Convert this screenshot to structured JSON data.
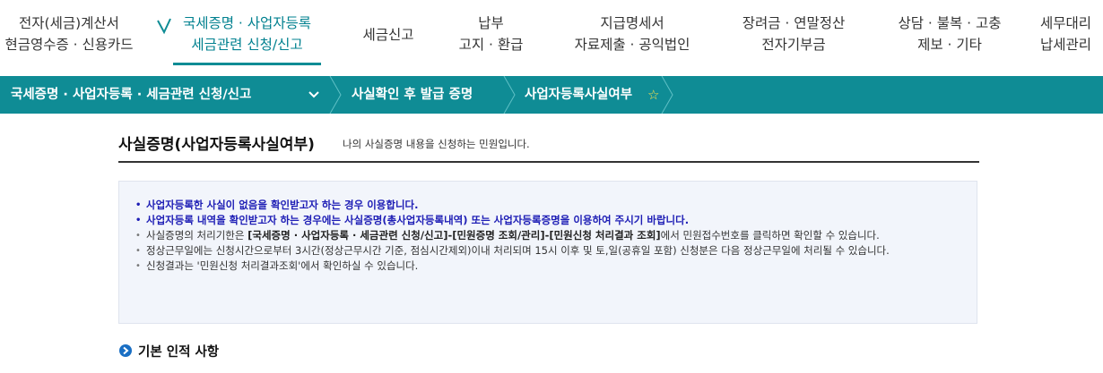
{
  "top_menu": [
    {
      "lines": [
        "전자(세금)계산서",
        "현금영수증 · 신용카드"
      ]
    },
    {
      "lines": [
        "국세증명 · 사업자등록",
        "세금관련 신청/신고"
      ],
      "active": true
    },
    {
      "lines": [
        "세금신고"
      ]
    },
    {
      "lines": [
        "납부",
        "고지 · 환급"
      ]
    },
    {
      "lines": [
        "지급명세서",
        "자료제출 · 공익법인"
      ]
    },
    {
      "lines": [
        "장려금 · 연말정산",
        "전자기부금"
      ]
    },
    {
      "lines": [
        "상담 · 불복 · 고충",
        "제보 · 기타"
      ]
    },
    {
      "lines": [
        "세무대리",
        "납세관리"
      ]
    }
  ],
  "breadcrumb": {
    "items": [
      "국세증명 · 사업자등록 · 세금관련 신청/신고",
      "사실확인 후 발급 증명",
      "사업자등록사실여부"
    ],
    "star": "☆"
  },
  "page": {
    "title": "사실증명(사업자등록사실여부)",
    "subtitle": "나의 사실증명 내용을 신청하는 민원입니다."
  },
  "notice": {
    "items": [
      {
        "text": "사업자등록한 사실이 없음을 확인받고자 하는 경우 이용합니다.",
        "strong": true
      },
      {
        "text": "사업자등록 내역을 확인받고자 하는 경우에는 사실증명(총사업자등록내역) 또는 사업자등록증명을 이용하여 주시기 바랍니다.",
        "strong": true
      },
      {
        "pre": "사실증명의 처리기한은 ",
        "bold": "[국세증명 · 사업자등록 · 세금관련 신청/신고]-[민원증명 조회/관리]-[민원신청 처리결과 조회]",
        "post": "에서 민원접수번호를 클릭하면 확인할 수 있습니다."
      },
      {
        "text": "정상근무일에는 신청시간으로부터 3시간(정상근무시간 기준, 점심시간제외)이내 처리되며 15시 이후 및 토,일(공휴일 포함) 신청분은 다음 정상근무일에 처리될 수 있습니다."
      },
      {
        "text": "신청결과는 '민원신청 처리결과조회'에서 확인하실 수 있습니다."
      }
    ]
  },
  "section": {
    "title": "기본 인적 사항"
  },
  "colors": {
    "accent": "#0f8c95",
    "notice_strong": "#1d1db5",
    "section_icon": "#1a6fc4"
  }
}
